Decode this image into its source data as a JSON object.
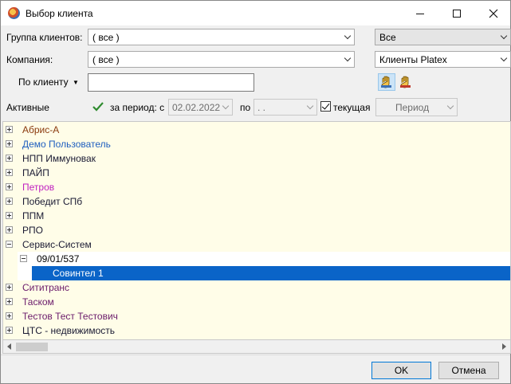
{
  "window": {
    "title": "Выбор клиента"
  },
  "filters": {
    "group_label": "Группа клиентов:",
    "group_value": "( все )",
    "company_label": "Компания:",
    "company_value": "( все )",
    "right_combo1_value": "Все",
    "right_combo2_value": "Клиенты Platex",
    "by_client_label": "По клиенту",
    "by_client_value": "",
    "active_label": "Активные",
    "period_from_label": "за период: с",
    "date_from": "02.02.2022",
    "period_to_label": "по",
    "date_to": " .  .",
    "current_label": "текущая",
    "period_button": "Период"
  },
  "colors": {
    "brown": "#8b3a0e",
    "blue": "#1f5fbf",
    "dark": "#1a1a33",
    "magenta": "#c020c0",
    "purple": "#6a1a6a",
    "black": "#000000",
    "white": "#ffffff"
  },
  "tree": {
    "rows": [
      {
        "name": "Абрис-А",
        "color": "#8b3a0e",
        "expander": "plus"
      },
      {
        "name": "Демо Пользователь",
        "color": "#1f5fbf",
        "expander": "plus"
      },
      {
        "name": "НПП Иммуновак",
        "color": "#1a1a33",
        "expander": "plus"
      },
      {
        "name": "ПАЙП",
        "color": "#1a1a33",
        "expander": "plus"
      },
      {
        "name": "Петров",
        "color": "#c020c0",
        "expander": "plus"
      },
      {
        "name": "Победит СПб",
        "color": "#1a1a33",
        "expander": "plus"
      },
      {
        "name": "ППМ",
        "color": "#1a1a33",
        "expander": "plus"
      },
      {
        "name": "РПО",
        "color": "#1a1a33",
        "expander": "plus"
      },
      {
        "name": "Сервис-Систем",
        "color": "#1a1a33",
        "expander": "minus"
      },
      {
        "name": "09/01/537",
        "color": "#000000",
        "expander": "minus",
        "level": 1
      },
      {
        "name": "Совинтел 1",
        "color": "#ffffff",
        "expander": "none",
        "level": 2,
        "selected": true
      },
      {
        "name": "Сититранс",
        "color": "#6a1a6a",
        "expander": "plus"
      },
      {
        "name": "Таском",
        "color": "#6a1a6a",
        "expander": "plus"
      },
      {
        "name": "Тестов Тест Тестович",
        "color": "#6a1a6a",
        "expander": "plus"
      },
      {
        "name": "ЦТС - недвижимость",
        "color": "#1a1a33",
        "expander": "plus"
      }
    ]
  },
  "buttons": {
    "ok": "OK",
    "cancel": "Отмена"
  }
}
